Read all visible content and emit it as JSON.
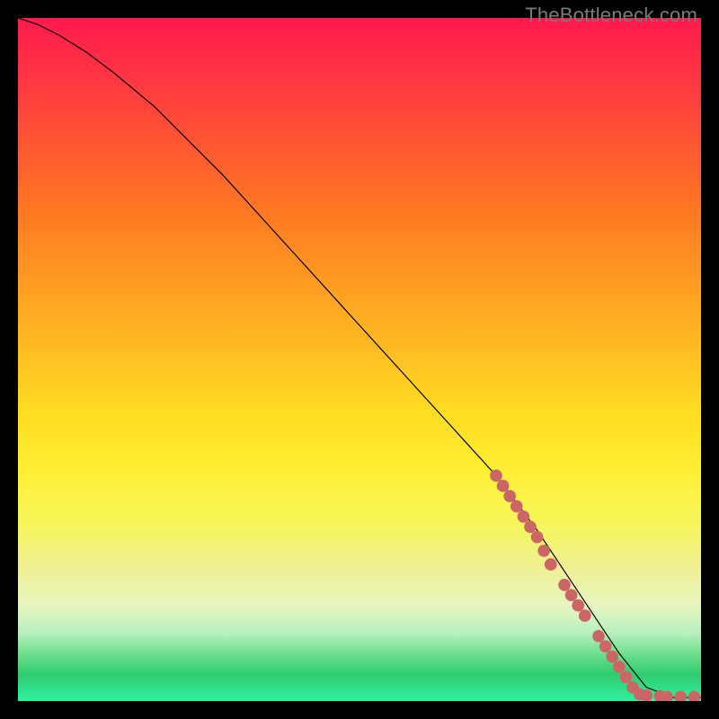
{
  "watermark": "TheBottleneck.com",
  "chart_data": {
    "type": "line",
    "title": "",
    "xlabel": "",
    "ylabel": "",
    "xlim": [
      0,
      100
    ],
    "ylim": [
      0,
      100
    ],
    "series": [
      {
        "name": "curve",
        "style": "line",
        "color": "#000000",
        "x": [
          0,
          3,
          6,
          10,
          14,
          20,
          30,
          40,
          50,
          60,
          70,
          76,
          80,
          84,
          88,
          92,
          96,
          100
        ],
        "y": [
          100,
          99,
          97.5,
          95,
          92,
          87,
          77,
          66,
          55,
          44,
          33,
          25,
          19,
          13,
          7,
          2,
          0.5,
          0.5
        ]
      },
      {
        "name": "highlight-dots",
        "style": "scatter",
        "color": "#cc6666",
        "x": [
          70,
          71,
          72,
          73,
          74,
          75,
          76,
          77,
          78,
          80,
          81,
          82,
          83,
          85,
          86,
          87,
          88,
          89,
          90,
          91,
          92,
          94,
          95,
          97,
          99
        ],
        "y": [
          33,
          31.5,
          30,
          28.5,
          27,
          25.5,
          24,
          22,
          20,
          17,
          15.5,
          14,
          12.5,
          9.5,
          8,
          6.5,
          5,
          3.5,
          2,
          1,
          0.8,
          0.7,
          0.6,
          0.6,
          0.6
        ]
      }
    ]
  }
}
